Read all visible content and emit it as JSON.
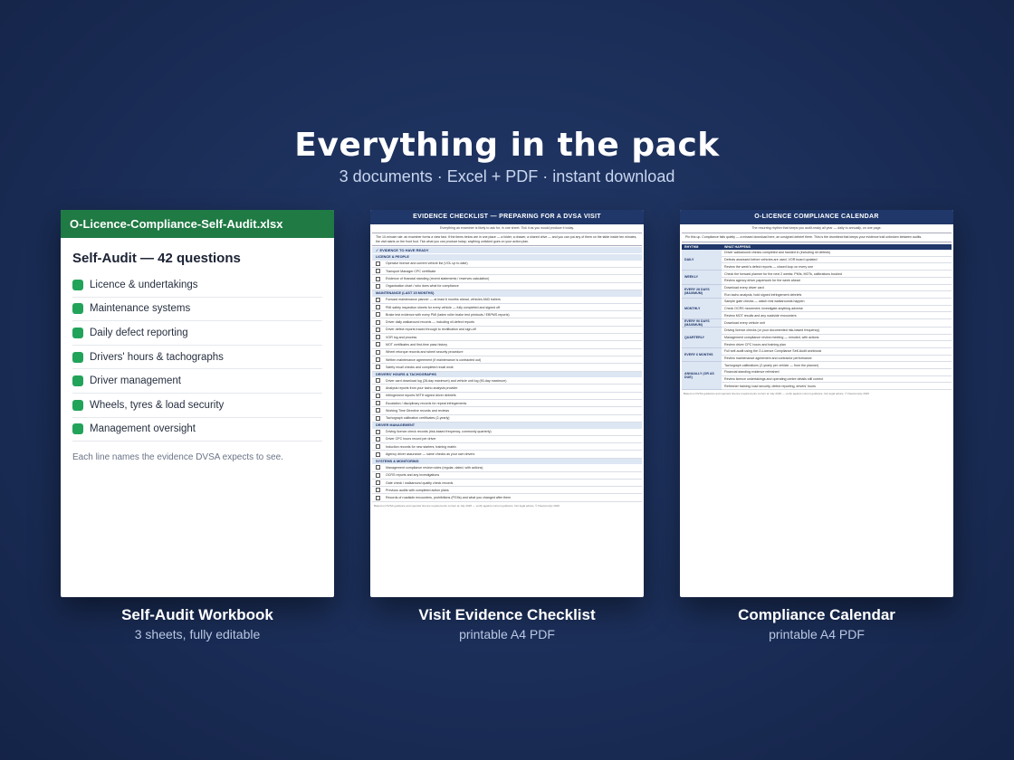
{
  "headline": "Everything in the pack",
  "subhead": "3 documents · Excel + PDF · instant download",
  "card1": {
    "filename": "O-Licence-Compliance-Self-Audit.xlsx",
    "title": "Self-Audit — 42 questions",
    "items": [
      "Licence & undertakings",
      "Maintenance systems",
      "Daily defect reporting",
      "Drivers' hours & tachographs",
      "Driver management",
      "Wheels, tyres & load security",
      "Management oversight"
    ],
    "note": "Each line names the evidence DVSA expects to see.",
    "caption_title": "Self-Audit Workbook",
    "caption_sub": "3 sheets, fully editable",
    "accent": "#1f7a43",
    "bullet_color": "#22a35a"
  },
  "card2": {
    "header": "EVIDENCE CHECKLIST — PREPARING FOR A DVSA VISIT",
    "intro": "Everything an examiner is likely to ask for, in one sheet. Tick it as you would produce it today.",
    "rule": "The 10-minute rule: an examiner forms a view fast. If the items below are in one place — a folder, a drawer, a shared drive — and you can put any of them on the table inside ten minutes, the visit starts on the front foot. Tick what you can produce today; anything unticked goes on your action plan.",
    "ready": "EVIDENCE TO HAVE READY",
    "sections": [
      {
        "title": "LICENCE & PEOPLE",
        "rows": [
          "Operator licence and current vehicle list (VOL up to date)",
          "Transport Manager CPC certificate",
          "Evidence of financial standing (recent statements / reserves calculation)",
          "Organisation chart / who does what for compliance"
        ]
      },
      {
        "title": "MAINTENANCE (LAST 15 MONTHS)",
        "rows": [
          "Forward maintenance planner — at least 6 months ahead, vehicles AND trailers",
          "PMI safety inspection sheets for every vehicle — fully completed and signed off",
          "Brake test evidence with every PMI (laden roller brake test printouts / EBPMS reports)",
          "Driver daily walkaround records — including nil-defect reports",
          "Driver defect reports traced through to rectification and sign-off",
          "VOR log and process",
          "MOT certificates and first-time pass history",
          "Wheel retorque records and wheel security procedure",
          "Written maintenance agreement (if maintenance is contracted out)",
          "Safety recall checks and completed recall work"
        ]
      },
      {
        "title": "DRIVERS' HOURS & TACHOGRAPHS",
        "rows": [
          "Driver card download log (28-day maximum) and vehicle unit log (90-day maximum)",
          "Analysis reports from your tacho analysis provider",
          "Infringement reports WITH signed driver debriefs",
          "Escalation / disciplinary records for repeat infringements",
          "Working Time Directive records and reviews",
          "Tachograph calibration certificates (2-yearly)"
        ]
      },
      {
        "title": "DRIVER MANAGEMENT",
        "rows": [
          "Driving licence check records (risk-based frequency, commonly quarterly)",
          "Driver CPC hours record per driver",
          "Induction records for new starters; training matrix",
          "Agency driver assurance — same checks as your own drivers"
        ]
      },
      {
        "title": "SYSTEMS & MONITORING",
        "rows": [
          "Management compliance review notes (regular, dated, with actions)",
          "OCRS reports and any investigations",
          "Gate check / walkaround quality check records",
          "Previous audits with completed action plans",
          "Records of roadside encounters, prohibitions (PG9s) and what you changed after them"
        ]
      }
    ],
    "footer": "Based on DVSA guidance and operator licence requirements current at July 2026 — verify against current guidance. Not legal advice. © Fleetcomply 2026",
    "caption_title": "Visit Evidence Checklist",
    "caption_sub": "printable A4 PDF",
    "accent": "#1f3769"
  },
  "card3": {
    "header": "O-LICENCE COMPLIANCE CALENDAR",
    "intro": "The recurring rhythm that keeps you audit-ready all year — daily to annually, on one page.",
    "warn": "Pin this up. Compliance fails quietly — a missed download here, an unsigned debrief there. This is the drumbeat that keeps your evidence trail unbroken between audits.",
    "col_rhythm": "RHYTHM",
    "col_what": "WHAT HAPPENS",
    "groups": [
      {
        "rhythm": "DAILY",
        "rows": [
          "Driver walkaround checks completed and handed in (including nil defects)",
          "Defects assessed before vehicles are used; VOR board updated",
          "Review the week's defect reports — closed loop on every one"
        ]
      },
      {
        "rhythm": "WEEKLY",
        "rows": [
          "Check the forward planner for the next 2 weeks: PMIs, MOTs, calibrations booked",
          "Review agency driver paperwork for the week ahead"
        ]
      },
      {
        "rhythm": "EVERY 28 DAYS (MAXIMUM)",
        "rows": [
          "Download every driver card",
          "Run tacho analysis; hold signed infringement debriefs"
        ]
      },
      {
        "rhythm": "MONTHLY",
        "rows": [
          "Sample gate checks — watch real walkarounds happen",
          "Check OCRS movement; investigate anything adverse",
          "Review MOT results and any roadside encounters"
        ]
      },
      {
        "rhythm": "EVERY 90 DAYS (MAXIMUM)",
        "rows": [
          "Download every vehicle unit"
        ]
      },
      {
        "rhythm": "QUARTERLY",
        "rows": [
          "Driving licence checks (or your documented risk-based frequency)",
          "Management compliance review meeting — minuted, with actions",
          "Review driver CPC hours and training plan"
        ]
      },
      {
        "rhythm": "EVERY 6 MONTHS",
        "rows": [
          "Full self-audit using the O-Licence Compliance Self-Audit workbook",
          "Review maintenance agreement and contractor performance"
        ]
      },
      {
        "rhythm": "ANNUALLY (OR AS DUE)",
        "rows": [
          "Tachograph calibrations (2-yearly per vehicle — from the planner)",
          "Financial standing evidence refreshed",
          "Review licence undertakings and operating centre details still correct",
          "Refresher training: load security, defect reporting, drivers' hours"
        ]
      }
    ],
    "footer": "Based on DVSA guidance and operator licence requirements current at July 2026 — verify against current guidance. Not legal advice. © Fleetcomply 2026",
    "caption_title": "Compliance Calendar",
    "caption_sub": "printable A4 PDF",
    "accent": "#1f3769"
  }
}
